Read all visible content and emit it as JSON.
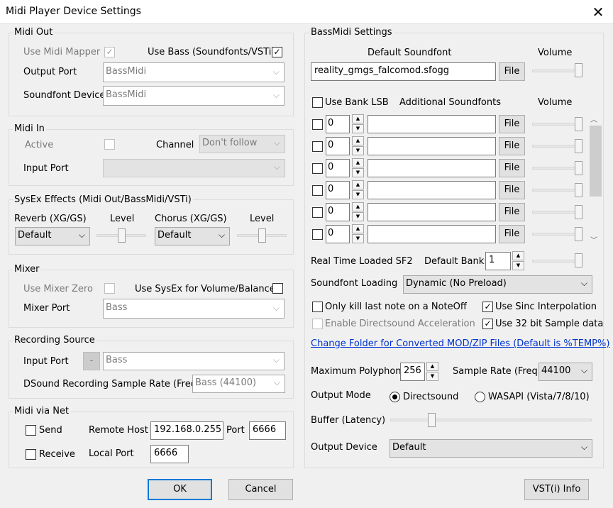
{
  "window": {
    "title": "Midi Player Device Settings"
  },
  "midi_out": {
    "legend": "Midi Out",
    "use_midi_mapper": "Use Midi Mapper",
    "use_bass": "Use Bass (Soundfonts/VSTi)",
    "output_port_label": "Output Port",
    "output_port_value": "BassMidi",
    "soundfont_device_label": "Soundfont Device",
    "soundfont_device_value": "BassMidi"
  },
  "midi_in": {
    "legend": "Midi In",
    "active": "Active",
    "channel_label": "Channel",
    "channel_value": "Don't follow",
    "input_port_label": "Input Port",
    "input_port_value": ""
  },
  "sysex": {
    "legend": "SysEx Effects (Midi Out/BassMidi/VSTi)",
    "reverb_label": "Reverb (XG/GS)",
    "reverb_value": "Default",
    "level1": "Level",
    "chorus_label": "Chorus (XG/GS)",
    "chorus_value": "Default",
    "level2": "Level"
  },
  "mixer": {
    "legend": "Mixer",
    "use_mixer_zero": "Use Mixer Zero",
    "use_sysex": "Use SysEx for Volume/Balance",
    "mixer_port_label": "Mixer Port",
    "mixer_port_value": "Bass"
  },
  "recording": {
    "legend": "Recording Source",
    "input_port_label": "Input Port",
    "dash": "-",
    "input_port_value": "Bass",
    "rate_label": "DSound Recording Sample Rate (Freq)",
    "rate_value": "Bass (44100)"
  },
  "net": {
    "legend": "Midi via Net",
    "send": "Send",
    "receive": "Receive",
    "remote_host_label": "Remote Host",
    "remote_host_value": "192.168.0.255",
    "port_label": "Port",
    "port_value": "6666",
    "local_port_label": "Local Port",
    "local_port_value": "6666"
  },
  "bassmidi": {
    "legend": "BassMidi Settings",
    "default_sf_label": "Default Soundfont",
    "volume_label": "Volume",
    "default_sf_value": "reality_gmgs_falcomod.sfogg",
    "file": "File",
    "use_bank_lsb": "Use Bank LSB",
    "additional_label": "Additional Soundfonts",
    "volume_label2": "Volume",
    "rows": [
      {
        "bank": "0",
        "name": "",
        "file": "File"
      },
      {
        "bank": "0",
        "name": "",
        "file": "File"
      },
      {
        "bank": "0",
        "name": "",
        "file": "File"
      },
      {
        "bank": "0",
        "name": "",
        "file": "File"
      },
      {
        "bank": "0",
        "name": "",
        "file": "File"
      },
      {
        "bank": "0",
        "name": "",
        "file": "File"
      }
    ],
    "realtime_label": "Real Time Loaded SF2",
    "default_bank_label": "Default Bank:",
    "default_bank_value": "1",
    "loading_label": "Soundfont Loading",
    "loading_value": "Dynamic (No Preload)",
    "kill_last": "Only kill last note on a NoteOff",
    "use_sinc": "Use Sinc Interpolation",
    "enable_ds": "Enable Directsound Acceleration",
    "use_32bit": "Use 32 bit Sample data",
    "change_folder": "Change Folder for Converted MOD/ZIP Files (Default is %TEMP%)",
    "max_poly_label": "Maximum Polyphony",
    "max_poly_value": "256",
    "sample_rate_label": "Sample Rate (Freq)",
    "sample_rate_value": "44100",
    "output_mode_label": "Output Mode",
    "directsound": "Directsound",
    "wasapi": "WASAPI (Vista/7/8/10)",
    "buffer_label": "Buffer (Latency)",
    "output_device_label": "Output Device",
    "output_device_value": "Default"
  },
  "buttons": {
    "ok": "OK",
    "cancel": "Cancel",
    "vsti_info": "VST(i) Info"
  },
  "checks": {
    "check": "✓"
  },
  "icons": {
    "close": "✕",
    "chevron": "⌵",
    "up": "▲",
    "down": "▼"
  }
}
